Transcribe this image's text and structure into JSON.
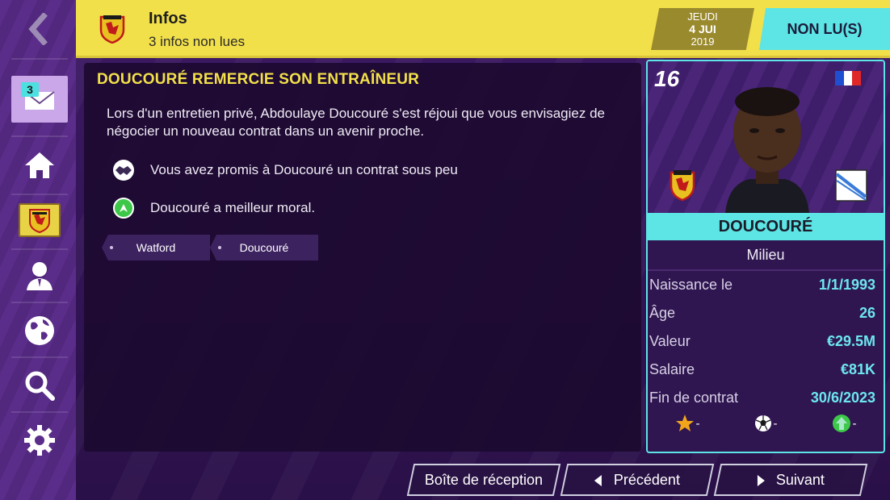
{
  "header": {
    "title": "Infos",
    "subtitle": "3 infos non lues",
    "club_logo": "watford-crest",
    "date": {
      "weekday": "JEUDI",
      "day_month": "4 JUI",
      "year": "2019"
    },
    "unread_label": "NON LU(S)"
  },
  "sidebar": {
    "items": [
      {
        "name": "inbox",
        "icon": "mail-icon",
        "badge": "3"
      },
      {
        "name": "home",
        "icon": "home-icon"
      },
      {
        "name": "club",
        "icon": "watford-crest"
      },
      {
        "name": "staff",
        "icon": "person-icon"
      },
      {
        "name": "world",
        "icon": "globe-icon"
      },
      {
        "name": "search",
        "icon": "search-icon"
      },
      {
        "name": "settings",
        "icon": "gear-icon"
      }
    ]
  },
  "message": {
    "title": "DOUCOURÉ REMERCIE SON ENTRAÎNEUR",
    "body": "Lors d'un entretien privé, Abdoulaye Doucouré s'est réjoui que vous envisagiez de négocier un nouveau contrat dans un avenir proche.",
    "outcomes": [
      {
        "icon": "handshake-icon",
        "text": "Vous avez promis à Doucouré un contrat sous peu"
      },
      {
        "icon": "morale-up-icon",
        "text": "Doucouré a meilleur moral."
      }
    ],
    "tags": [
      "Watford",
      "Doucouré"
    ]
  },
  "player_card": {
    "number": "16",
    "nationality_flag": "france",
    "name": "DOUCOURÉ",
    "position": "Milieu",
    "stats": [
      {
        "label": "Naissance le",
        "value": "1/1/1993"
      },
      {
        "label": "Âge",
        "value": "26"
      },
      {
        "label": "Valeur",
        "value": "€29.5M"
      },
      {
        "label": "Salaire",
        "value": "€81K"
      },
      {
        "label": "Fin de contrat",
        "value": "30/6/2023"
      }
    ],
    "icons": [
      {
        "icon": "star-icon",
        "value": "-"
      },
      {
        "icon": "ball-icon",
        "value": "-"
      },
      {
        "icon": "arrow-up-icon",
        "value": "-"
      }
    ]
  },
  "footer": {
    "inbox_label": "Boîte de réception",
    "prev_label": "Précédent",
    "next_label": "Suivant"
  },
  "colors": {
    "header_yellow": "#f2e04a",
    "accent_cyan": "#5de4e4",
    "title_yellow": "#f2e04a",
    "panel_dark": "#1c0a30",
    "sidebar_purple": "#5b2d8a"
  }
}
